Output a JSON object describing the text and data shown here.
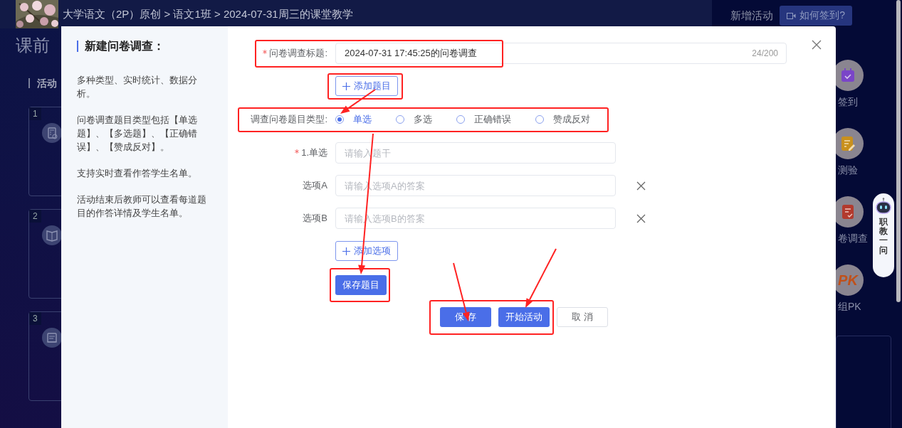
{
  "header": {
    "breadcrumb": "大学语文（2P）原创 > 语文1班 > 2024-07-31周三的课堂教学",
    "add_activity_label": "新增活动",
    "help_button": "如何签到?"
  },
  "page_title": "课前",
  "activity_section": {
    "title": "活动",
    "cards": [
      {
        "number": "1",
        "kind": "calculator"
      },
      {
        "number": "2",
        "kind": "book"
      },
      {
        "number": "3",
        "kind": "scroll"
      }
    ]
  },
  "tools": [
    {
      "label": "签到",
      "kind": "checkin"
    },
    {
      "label": "测验",
      "kind": "quiz"
    },
    {
      "label": "卷调查",
      "kind": "survey"
    },
    {
      "label": "组PK",
      "kind": "pk",
      "icon_text": "PK"
    }
  ],
  "assistant": {
    "label": "职教一问"
  },
  "dialog": {
    "title": "新建问卷调查：",
    "intro": [
      "多种类型、实时统计、数据分析。",
      "问卷调查题目类型包括【单选题】、【多选题】、【正确错误】、【赞成反对】。",
      "支持实时查看作答学生名单。",
      "活动结束后教师可以查看每道题目的作答详情及学生名单。"
    ],
    "form": {
      "title_field": {
        "label": "问卷调查标题:",
        "required": true,
        "value": "2024-07-31 17:45:25的问卷调查",
        "counter": "24/200"
      },
      "add_question_button": "添加题目",
      "type_field": {
        "label": "调查问卷题目类型:",
        "options": [
          {
            "label": "单选",
            "selected": true
          },
          {
            "label": "多选",
            "selected": false
          },
          {
            "label": "正确错误",
            "selected": false
          },
          {
            "label": "赞成反对",
            "selected": false
          }
        ]
      },
      "question": {
        "label": "1.单选",
        "required": true,
        "placeholder": "请输入题干"
      },
      "options": [
        {
          "label": "选项A",
          "placeholder": "请输入选项A的答案"
        },
        {
          "label": "选项B",
          "placeholder": "请输入选项B的答案"
        }
      ],
      "add_option_button": "添加选项",
      "save_question_button": "保存题目"
    },
    "footer_buttons": [
      {
        "label": "保 存",
        "kind": "primary"
      },
      {
        "label": "开始活动",
        "kind": "primary"
      },
      {
        "label": "取 消",
        "kind": "default"
      }
    ]
  }
}
